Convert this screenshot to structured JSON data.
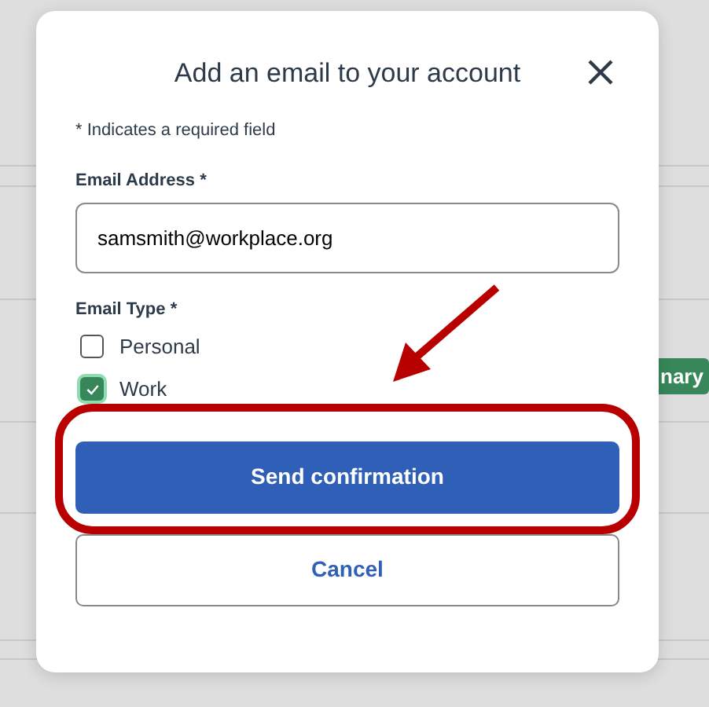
{
  "background": {
    "badge": "nary"
  },
  "dialog": {
    "title": "Add an email to your account",
    "required_note": "* Indicates a required field",
    "email_field": {
      "label": "Email Address *",
      "value": "samsmith@workplace.org"
    },
    "email_type": {
      "label": "Email Type *",
      "options": [
        {
          "label": "Personal",
          "checked": false
        },
        {
          "label": "Work",
          "checked": true
        }
      ]
    },
    "buttons": [
      {
        "label": "Send confirmation",
        "kind": "primary"
      },
      {
        "label": "Cancel",
        "kind": "secondary"
      }
    ]
  }
}
